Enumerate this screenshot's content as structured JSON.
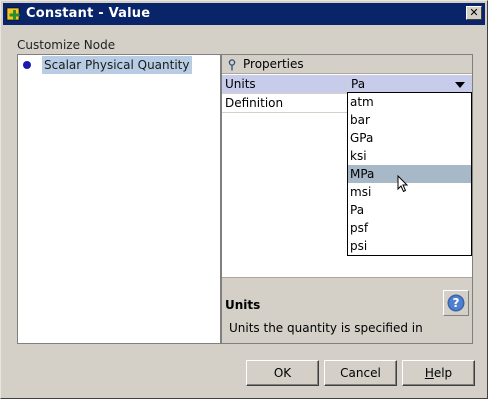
{
  "window": {
    "title": "Constant - Value",
    "close_glyph": "✕"
  },
  "left": {
    "section_label": "Customize Node",
    "tree_node_label": "Scalar Physical Quantity"
  },
  "properties": {
    "header": "Properties",
    "rows": [
      {
        "name": "Units",
        "value": "Pa"
      },
      {
        "name": "Definition",
        "value": ""
      }
    ],
    "units_dropdown": {
      "selected": "Pa",
      "highlighted": "MPa",
      "options": [
        "atm",
        "bar",
        "GPa",
        "ksi",
        "MPa",
        "msi",
        "Pa",
        "psf",
        "psi"
      ]
    },
    "help_title": "Units",
    "help_description": "Units the quantity is specified in"
  },
  "buttons": {
    "ok": "OK",
    "cancel": "Cancel",
    "help_mnemonic": "H",
    "help_rest": "elp"
  },
  "colors": {
    "titlebar": "#0a246a",
    "selection": "#c6cce9",
    "dropdown_highlight": "#a7b8c9"
  }
}
